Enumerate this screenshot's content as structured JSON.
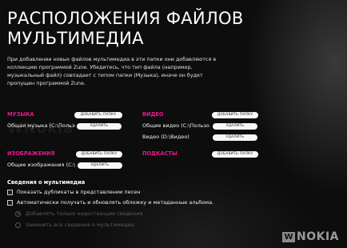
{
  "page": {
    "title": "РАСПОЛОЖЕНИЯ ФАЙЛОВ МУЛЬТИМЕДИА",
    "description": "При добавлении новых файлов мультимедиа в эти папки они добавляются в коллекцию программой Zune. Убедитесь, что тип файла (например, музыкальный файл) совпадает с типом папки (Музыка), иначе он будет пропущен программой Zune."
  },
  "music": {
    "title": "МУЗЫКА",
    "add_button": "ДОБАВИТЬ ПАПКУ",
    "folders": [
      {
        "path": "Общая музыка (C:\\Пользо",
        "remove": "УДАЛИТЬ"
      }
    ]
  },
  "video": {
    "title": "ВИДЕО",
    "add_button": "ДОБАВИТЬ ПАПКУ",
    "folders": [
      {
        "path": "Общие видео (C:\\Пользо",
        "remove": "УДАЛИТЬ"
      },
      {
        "path": "Видео (D:\\Видео)",
        "remove": "УДАЛИТЬ"
      }
    ]
  },
  "images": {
    "title": "ИЗОБРАЖЕНИЯ",
    "add_button": "ДОБАВИТЬ ПАПКУ",
    "folders": [
      {
        "path": "Общие изображения (C:\\",
        "remove": "УДАЛИТЬ"
      }
    ]
  },
  "podcasts": {
    "title": "ПОДКАСТЫ",
    "add_button": "ДОБАВИТЬ ПАПКУ"
  },
  "media_info": {
    "title": "Сведения о мультимедиа",
    "options": [
      {
        "label": "Показать дубликаты в представлении песен",
        "checked": false
      },
      {
        "label": "Автоматически получать и обновлять обложку и метаданные альбома.",
        "checked": false
      }
    ],
    "radios": [
      {
        "label": "Добавлять только недостающие сведения",
        "selected": true
      },
      {
        "label": "Заменить все сведения о мультимедиа",
        "selected": false
      }
    ]
  },
  "watermark": {
    "left_text": "WNokia",
    "logo_box": "W",
    "logo_text": "NOKIA"
  },
  "colors": {
    "accent": "#ec178a",
    "background": "#0d0d0d",
    "button_bg": "#f7f7f7"
  }
}
